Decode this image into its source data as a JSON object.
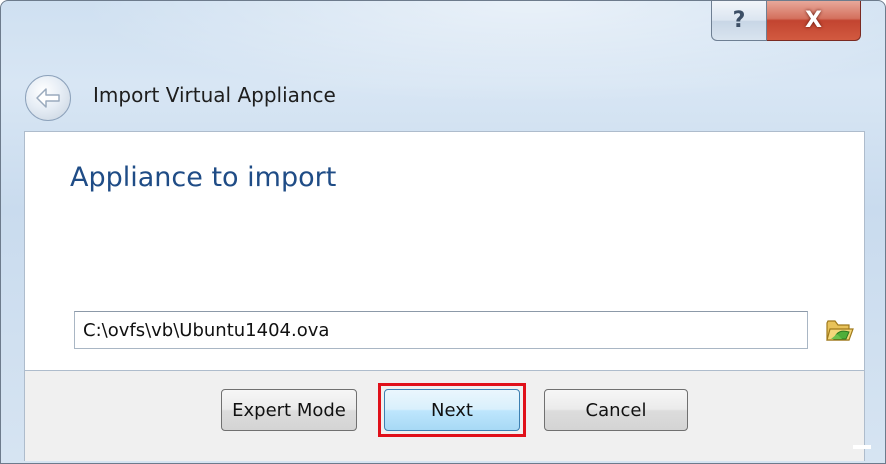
{
  "window": {
    "title": "Import Virtual Appliance",
    "help_label": "?",
    "close_label": "X"
  },
  "page": {
    "heading": "Appliance to import"
  },
  "file": {
    "path_value": "C:\\ovfs\\vb\\Ubuntu1404.ova"
  },
  "buttons": {
    "expert_label": "Expert Mode",
    "next_label": "Next",
    "cancel_label": "Cancel"
  },
  "colors": {
    "heading": "#1f4c86",
    "highlight": "#e0101a",
    "close": "#c24430"
  },
  "icons": {
    "back": "back-arrow-icon",
    "folder": "folder-open-icon"
  }
}
